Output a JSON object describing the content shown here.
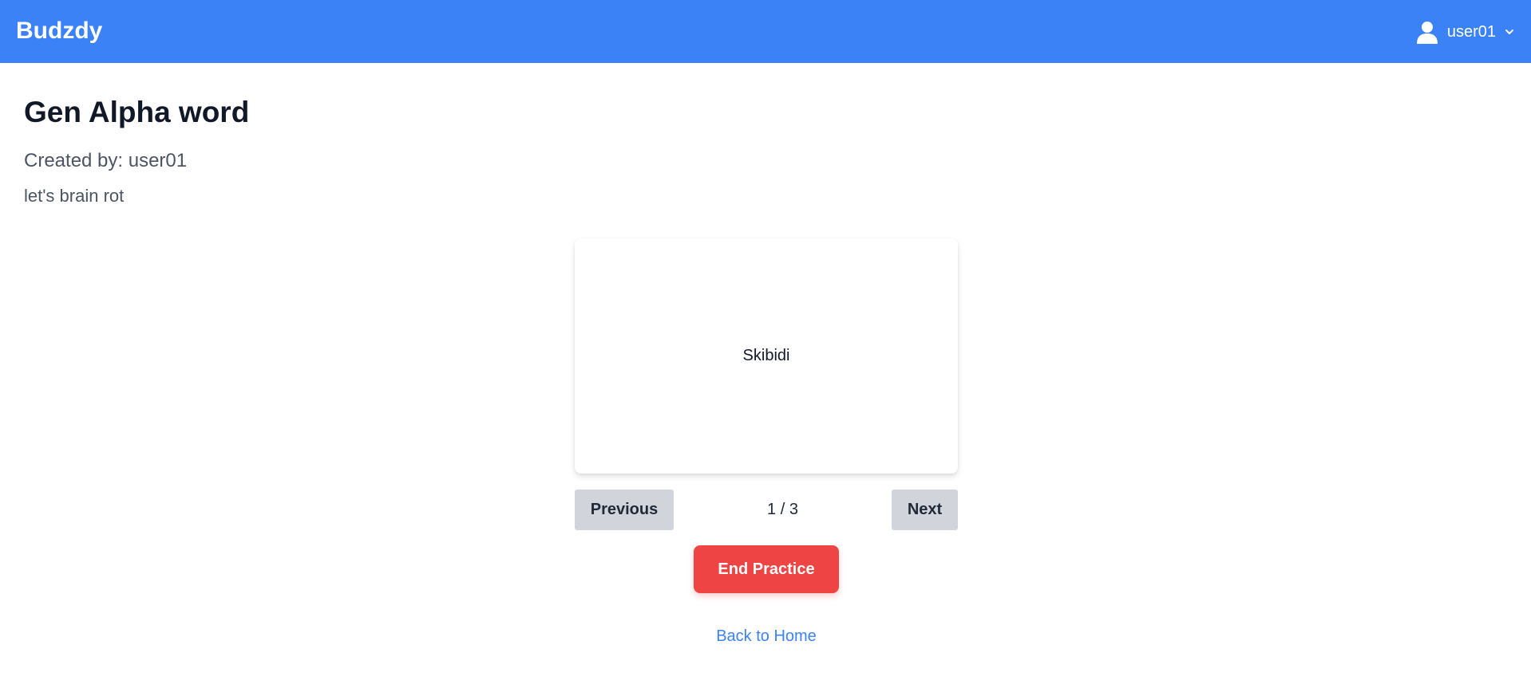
{
  "app": {
    "brand": "Budzdy"
  },
  "user_menu": {
    "username": "user01",
    "icon": "user-icon",
    "dropdown_icon": "chevron-down-icon"
  },
  "set": {
    "title": "Gen Alpha word",
    "created_by": "Created by: user01",
    "description": "let's brain rot"
  },
  "flashcard": {
    "text": "Skibidi"
  },
  "pagination": {
    "previous_label": "Previous",
    "counter": "1 / 3",
    "next_label": "Next"
  },
  "actions": {
    "end_practice_label": "End Practice",
    "back_home_label": "Back to Home"
  },
  "colors": {
    "primary": "#3b82f6",
    "danger": "#ef4444",
    "neutral_button": "#d1d5db"
  }
}
